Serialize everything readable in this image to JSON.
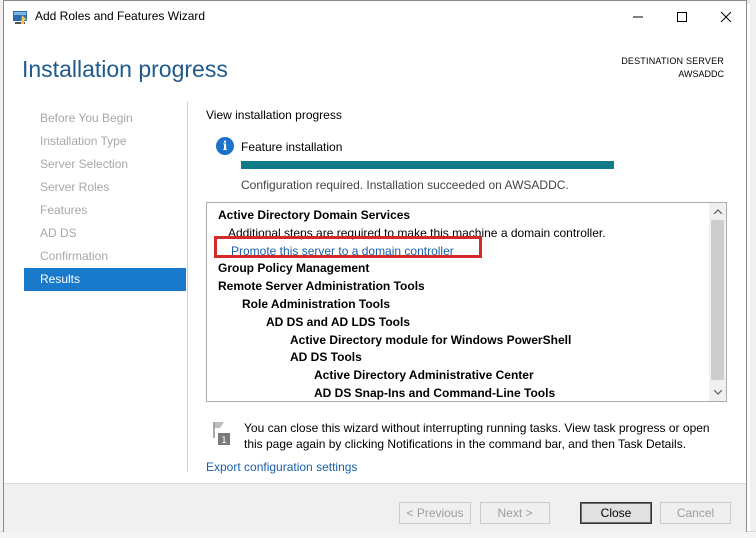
{
  "window": {
    "title": "Add Roles and Features Wizard"
  },
  "header": {
    "title": "Installation progress",
    "destination_label": "DESTINATION SERVER",
    "destination_server": "AWSADDC"
  },
  "nav": {
    "items": [
      {
        "label": "Before You Begin",
        "active": false
      },
      {
        "label": "Installation Type",
        "active": false
      },
      {
        "label": "Server Selection",
        "active": false
      },
      {
        "label": "Server Roles",
        "active": false
      },
      {
        "label": "Features",
        "active": false
      },
      {
        "label": "AD DS",
        "active": false
      },
      {
        "label": "Confirmation",
        "active": false
      },
      {
        "label": "Results",
        "active": true
      }
    ]
  },
  "main": {
    "view_label": "View installation progress",
    "feature_label": "Feature installation",
    "progress_fraction": 1.0,
    "status_text": "Configuration required. Installation succeeded on AWSADDC.",
    "results": [
      {
        "text": "Active Directory Domain Services",
        "indent": 0,
        "style": "bold"
      },
      {
        "text": "Additional steps are required to make this machine a domain controller.",
        "indent": 1,
        "style": "normal"
      },
      {
        "text": "Promote this server to a domain controller",
        "indent": 1,
        "style": "link"
      },
      {
        "text": "Group Policy Management",
        "indent": 0,
        "style": "bold"
      },
      {
        "text": "Remote Server Administration Tools",
        "indent": 0,
        "style": "bold"
      },
      {
        "text": "Role Administration Tools",
        "indent": 1,
        "style": "bold"
      },
      {
        "text": "AD DS and AD LDS Tools",
        "indent": 2,
        "style": "bold"
      },
      {
        "text": "Active Directory module for Windows PowerShell",
        "indent": 3,
        "style": "bold"
      },
      {
        "text": "AD DS Tools",
        "indent": 3,
        "style": "bold"
      },
      {
        "text": "Active Directory Administrative Center",
        "indent": 4,
        "style": "bold"
      },
      {
        "text": "AD DS Snap-Ins and Command-Line Tools",
        "indent": 4,
        "style": "bold"
      }
    ],
    "note": "You can close this wizard without interrupting running tasks. View task progress or open this page again by clicking Notifications in the command bar, and then Task Details.",
    "note_badge": "1",
    "export_link": "Export configuration settings"
  },
  "footer": {
    "previous_label": "< Previous",
    "next_label": "Next >",
    "close_label": "Close",
    "cancel_label": "Cancel"
  },
  "colors": {
    "accent": "#1979ca",
    "header_title": "#1f5a8c",
    "progress": "#0f7b86",
    "link": "#1a5ea8",
    "highlight": "#d32a2a"
  }
}
